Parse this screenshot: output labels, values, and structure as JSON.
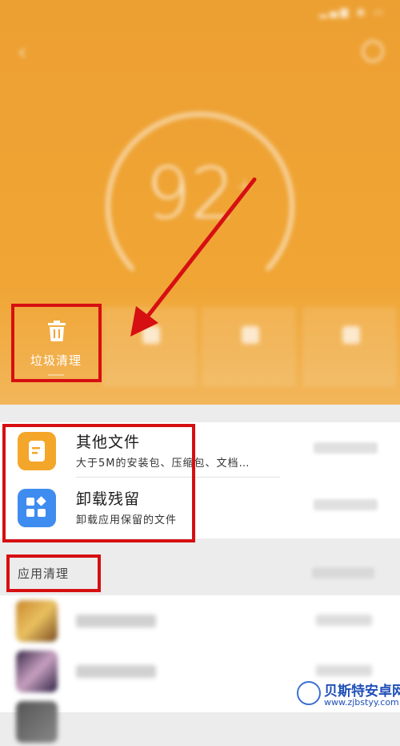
{
  "colors": {
    "accent_orange": "#F0A534",
    "annotation_red": "#D60F12",
    "icon_orange": "#F4A62A",
    "icon_blue": "#3F8CF0"
  },
  "status_bar": {
    "icons": [
      "signal-icon",
      "wifi-icon",
      "battery-icon"
    ]
  },
  "header": {
    "back_icon": "back-arrow-icon",
    "settings_icon": "settings-icon",
    "score": "92",
    "active_tile": {
      "icon": "trash-icon",
      "label": "垃圾清理"
    }
  },
  "cleanup_items": [
    {
      "icon": "document-icon",
      "title": "其他文件",
      "subtitle": "大于5M的安装包、压缩包、文档…"
    },
    {
      "icon": "apps-grid-icon",
      "title": "卸载残留",
      "subtitle": "卸载应用保留的文件"
    }
  ],
  "app_section": {
    "title": "应用清理"
  },
  "watermark": {
    "name": "贝斯特安卓网",
    "url": "www.zjbstyy.com"
  }
}
